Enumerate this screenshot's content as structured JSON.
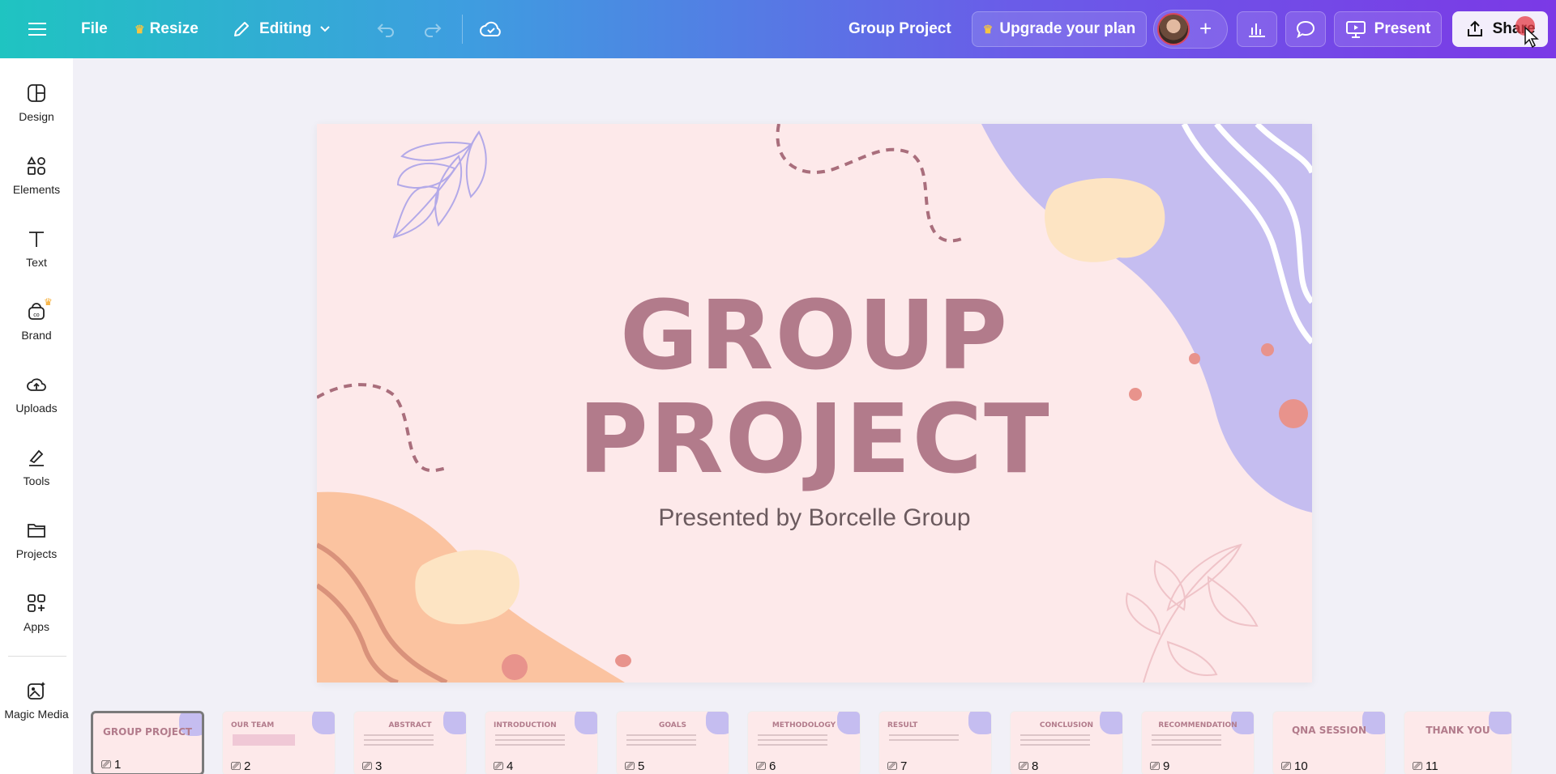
{
  "topbar": {
    "file_label": "File",
    "resize_label": "Resize",
    "editing_label": "Editing",
    "doc_title": "Group Project",
    "upgrade_label": "Upgrade your plan",
    "present_label": "Present",
    "share_label": "Share"
  },
  "sidebar": {
    "items": [
      {
        "label": "Design",
        "icon": "design-icon"
      },
      {
        "label": "Elements",
        "icon": "elements-icon"
      },
      {
        "label": "Text",
        "icon": "text-icon"
      },
      {
        "label": "Brand",
        "icon": "brand-icon"
      },
      {
        "label": "Uploads",
        "icon": "uploads-icon"
      },
      {
        "label": "Tools",
        "icon": "tools-icon"
      },
      {
        "label": "Projects",
        "icon": "projects-icon"
      },
      {
        "label": "Apps",
        "icon": "apps-icon"
      },
      {
        "label": "Magic Media",
        "icon": "magic-media-icon"
      }
    ]
  },
  "slide": {
    "title_line1": "GROUP",
    "title_line2": "PROJECT",
    "subtitle": "Presented by Borcelle Group"
  },
  "thumbnails": [
    {
      "num": "1",
      "title": "GROUP PROJECT",
      "active": true
    },
    {
      "num": "2",
      "title": "OUR TEAM"
    },
    {
      "num": "3",
      "title": "ABSTRACT"
    },
    {
      "num": "4",
      "title": "INTRODUCTION"
    },
    {
      "num": "5",
      "title": "GOALS"
    },
    {
      "num": "6",
      "title": "METHODOLOGY"
    },
    {
      "num": "7",
      "title": "RESULT"
    },
    {
      "num": "8",
      "title": "CONCLUSION"
    },
    {
      "num": "9",
      "title": "RECOMMENDATION"
    },
    {
      "num": "10",
      "title": "QNA SESSION"
    },
    {
      "num": "11",
      "title": "THANK YOU"
    }
  ],
  "colors": {
    "title": "#b27b8b",
    "slide_bg": "#fde9ea",
    "lavender": "#c5bdf0",
    "peach": "#fbc3a0",
    "cream": "#fde4c3"
  }
}
